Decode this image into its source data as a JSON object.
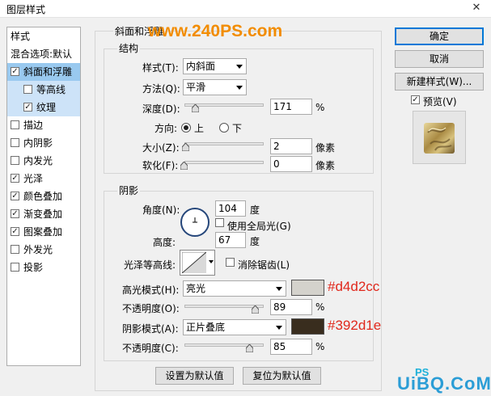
{
  "window": {
    "title": "图层样式",
    "close_glyph": "✕"
  },
  "watermark_top": "www.240PS.com",
  "watermark_bottom": "UiBQ.CoM",
  "left_list": {
    "header": "样式",
    "blend_options": "混合选项:默认",
    "items": [
      {
        "label": "斜面和浮雕",
        "checked": true
      },
      {
        "label": "等高线",
        "checked": false
      },
      {
        "label": "纹理",
        "checked": true
      },
      {
        "label": "描边",
        "checked": false
      },
      {
        "label": "内阴影",
        "checked": false
      },
      {
        "label": "内发光",
        "checked": false
      },
      {
        "label": "光泽",
        "checked": true
      },
      {
        "label": "颜色叠加",
        "checked": true
      },
      {
        "label": "渐变叠加",
        "checked": true
      },
      {
        "label": "图案叠加",
        "checked": true
      },
      {
        "label": "外发光",
        "checked": false
      },
      {
        "label": "投影",
        "checked": false
      }
    ]
  },
  "bevel": {
    "title": "斜面和浮雕",
    "structure": {
      "title": "结构",
      "style_label": "样式(T):",
      "style_value": "内斜面",
      "technique_label": "方法(Q):",
      "technique_value": "平滑",
      "depth_label": "深度(D):",
      "depth_value": "171",
      "depth_unit": "%",
      "direction_label": "方向:",
      "direction_up": "上",
      "direction_down": "下",
      "size_label": "大小(Z):",
      "size_value": "2",
      "size_unit": "像素",
      "soften_label": "软化(F):",
      "soften_value": "0",
      "soften_unit": "像素"
    },
    "shading": {
      "title": "阴影",
      "angle_label": "角度(N):",
      "angle_value": "104",
      "angle_unit": "度",
      "global_light": "使用全局光(G)",
      "altitude_label": "高度:",
      "altitude_value": "67",
      "altitude_unit": "度",
      "gloss_label": "光泽等高线:",
      "antialias": "消除锯齿(L)",
      "highlight_label": "高光模式(H):",
      "highlight_mode": "亮光",
      "highlight_color": "#d4d2cc",
      "highlight_color_text": "#d4d2cc",
      "opacity1_label": "不透明度(O):",
      "opacity1_value": "89",
      "opacity1_unit": "%",
      "shadow_label": "阴影模式(A):",
      "shadow_mode": "正片叠底",
      "shadow_color": "#392d1e",
      "shadow_color_text": "#392d1e",
      "opacity2_label": "不透明度(C):",
      "opacity2_value": "85",
      "opacity2_unit": "%"
    },
    "make_default": "设置为默认值",
    "reset_default": "复位为默认值"
  },
  "right": {
    "ok": "确定",
    "cancel": "取消",
    "new_style": "新建样式(W)...",
    "preview": "预览(V)"
  }
}
